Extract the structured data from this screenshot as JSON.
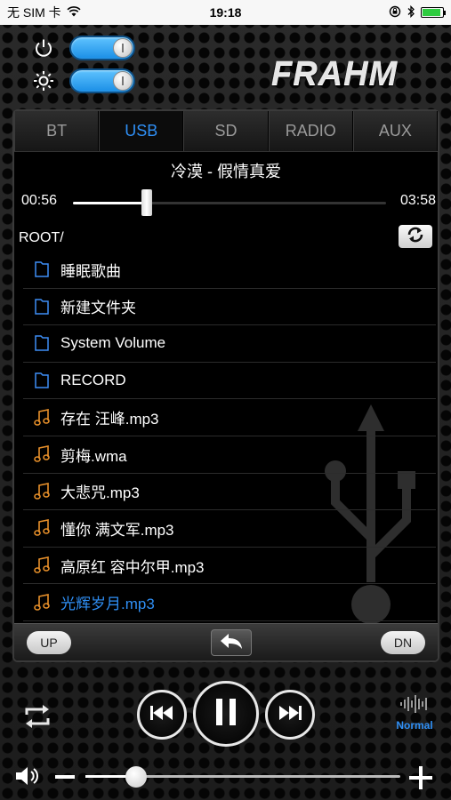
{
  "status_bar": {
    "carrier": "无 SIM 卡",
    "time": "19:18"
  },
  "brand": "FRAHM",
  "tabs": [
    {
      "label": "BT",
      "active": false
    },
    {
      "label": "USB",
      "active": true
    },
    {
      "label": "SD",
      "active": false
    },
    {
      "label": "RADIO",
      "active": false
    },
    {
      "label": "AUX",
      "active": false
    }
  ],
  "now_playing": {
    "title": "冷漠 - 假情真爱",
    "elapsed": "00:56",
    "duration": "03:58",
    "progress": 0.235
  },
  "browser": {
    "path": "ROOT/",
    "items": [
      {
        "type": "folder",
        "name": "睡眠歌曲"
      },
      {
        "type": "folder",
        "name": "新建文件夹"
      },
      {
        "type": "folder",
        "name": "System Volume"
      },
      {
        "type": "folder",
        "name": "RECORD"
      },
      {
        "type": "music",
        "name": "存在 汪峰.mp3"
      },
      {
        "type": "music",
        "name": "剪梅.wma"
      },
      {
        "type": "music",
        "name": "大悲咒.mp3"
      },
      {
        "type": "music",
        "name": "懂你 满文军.mp3"
      },
      {
        "type": "music",
        "name": "高原红 容中尔甲.mp3"
      },
      {
        "type": "music",
        "name": "光辉岁月.mp3",
        "playing": true
      }
    ]
  },
  "nav": {
    "up_label": "UP",
    "down_label": "DN"
  },
  "eq_mode": "Normal",
  "volume": {
    "level": 0.16
  },
  "colors": {
    "accent": "#2f8ff5",
    "music_icon": "#e8902a"
  }
}
